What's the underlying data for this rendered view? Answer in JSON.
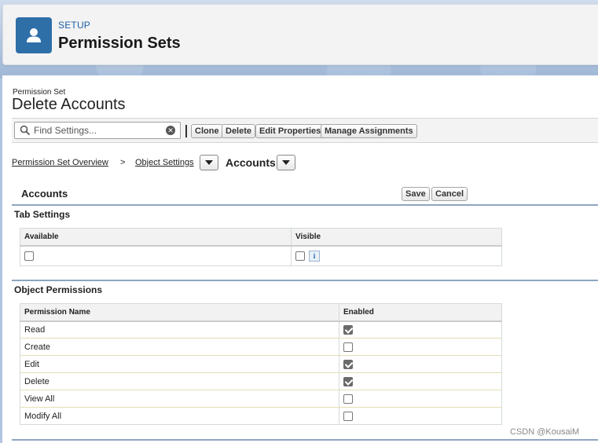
{
  "header": {
    "eyebrow": "SETUP",
    "title": "Permission Sets",
    "icon": "user-icon"
  },
  "page": {
    "eyebrow": "Permission Set",
    "title": "Delete Accounts"
  },
  "toolbar": {
    "search_placeholder": "Find Settings...",
    "buttons": [
      "Clone",
      "Delete",
      "Edit Properties",
      "Manage Assignments"
    ]
  },
  "breadcrumb": {
    "overview_link": "Permission Set Overview",
    "separator": ">",
    "object_settings_link": "Object Settings",
    "current": "Accounts"
  },
  "section": {
    "title": "Accounts",
    "save_label": "Save",
    "cancel_label": "Cancel"
  },
  "tab_settings": {
    "title": "Tab Settings",
    "columns": [
      "Available",
      "Visible"
    ],
    "available_checked": false,
    "visible_checked": false,
    "info_label": "i"
  },
  "object_permissions": {
    "title": "Object Permissions",
    "columns": [
      "Permission Name",
      "Enabled"
    ],
    "rows": [
      {
        "name": "Read",
        "enabled": true
      },
      {
        "name": "Create",
        "enabled": false
      },
      {
        "name": "Edit",
        "enabled": true
      },
      {
        "name": "Delete",
        "enabled": true
      },
      {
        "name": "View All",
        "enabled": false
      },
      {
        "name": "Modify All",
        "enabled": false
      }
    ]
  },
  "watermark": "CSDN @KousaiM",
  "colors": {
    "brand_icon": "#2e6fa8",
    "eyebrow_link": "#1b5fa5",
    "section_rule": "#8ea5c1"
  }
}
